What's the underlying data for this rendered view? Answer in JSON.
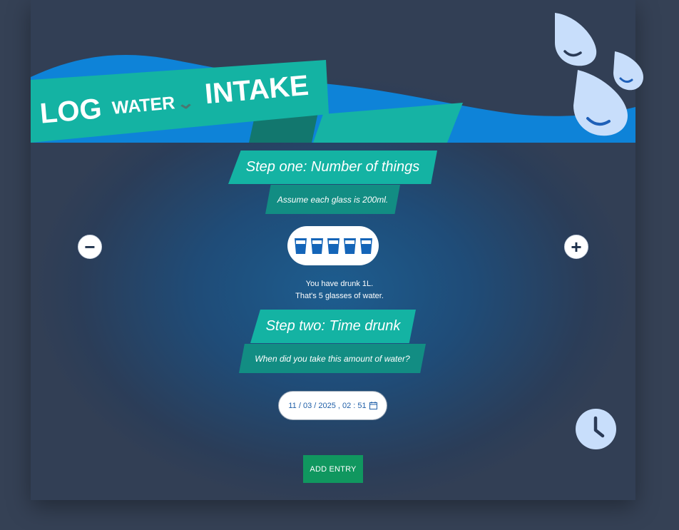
{
  "header": {
    "title_log": "LOG",
    "title_water": "WATER",
    "title_intake": "INTAKE",
    "caret_icon": "chevron-down-icon"
  },
  "step_one": {
    "title": "Step one: Number of things",
    "subtitle": "Assume each glass is 200ml."
  },
  "counter": {
    "minus_label": "−",
    "plus_label": "+",
    "glass_count": 5,
    "summary_line1": "You have drunk 1L.",
    "summary_line2": "That's 5 glasses of water."
  },
  "step_two": {
    "title": "Step two: Time drunk",
    "subtitle": "When did you take this amount of water?"
  },
  "datetime": {
    "value": "11 / 03 / 2025 ,  02 : 51"
  },
  "actions": {
    "add_entry": "ADD ENTRY"
  },
  "colors": {
    "background": "#354155",
    "teal": "#14b3a3",
    "teal_dark": "#128d83",
    "wave_blue": "#0f7fd4",
    "drop": "#c8defb",
    "add_button": "#10975f"
  }
}
